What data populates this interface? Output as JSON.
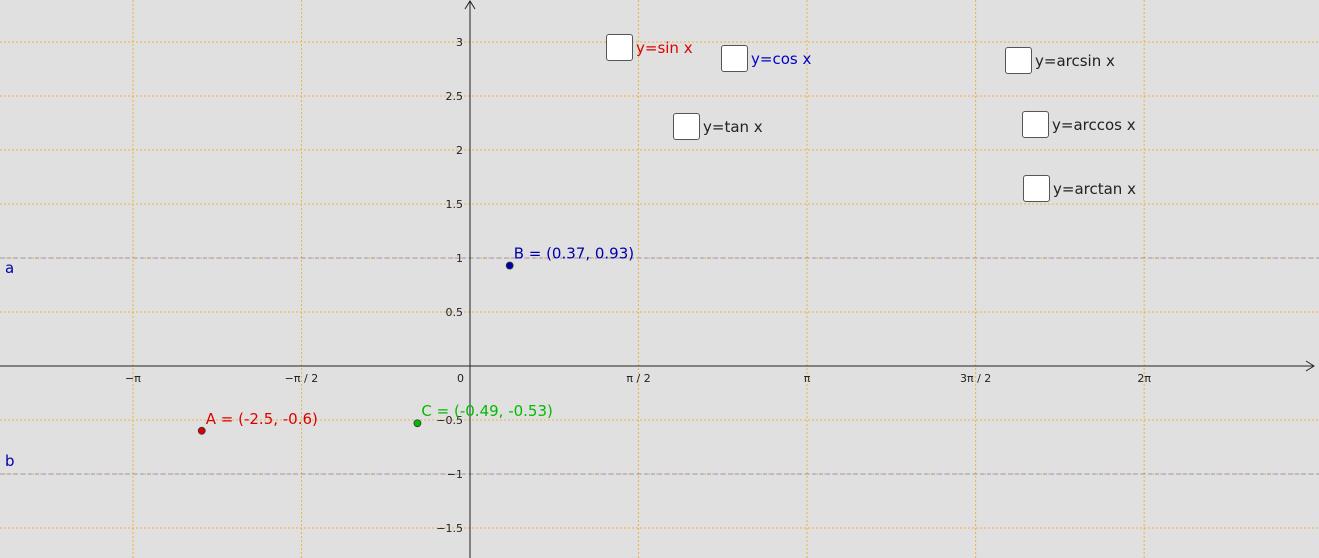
{
  "graph": {
    "x_ticks": [
      "−π",
      "−π / 2",
      "0",
      "π / 2",
      "π",
      "3π / 2",
      "2π"
    ],
    "y_ticks": [
      "3",
      "2.5",
      "2",
      "1.5",
      "1",
      "0.5",
      "−0.5",
      "−1",
      "−1.5"
    ],
    "lines": [
      {
        "name": "a",
        "y": 1,
        "color": "#0000aa"
      },
      {
        "name": "b",
        "y": -1,
        "color": "#0000aa"
      }
    ],
    "points": [
      {
        "label": "A = (-2.5, -0.6)",
        "x": -2.5,
        "y": -0.6,
        "color": "#dd0000"
      },
      {
        "label": "B = (0.37, 0.93)",
        "x": 0.37,
        "y": 0.93,
        "color": "#0000aa"
      },
      {
        "label": "C = (-0.49, -0.53)",
        "x": -0.49,
        "y": -0.53,
        "color": "#00bb00"
      }
    ]
  },
  "checkboxes": {
    "sin": {
      "label": "y=sin x",
      "checked": false,
      "color": "#dd0000"
    },
    "cos": {
      "label": "y=cos x",
      "checked": false,
      "color": "#0000cc"
    },
    "tan": {
      "label": "y=tan x",
      "checked": false,
      "color": "#222222"
    },
    "arcsin": {
      "label": "y=arcsin x",
      "checked": false,
      "color": "#222222"
    },
    "arccos": {
      "label": "y=arccos x",
      "checked": false,
      "color": "#222222"
    },
    "arctan": {
      "label": "y=arctan x",
      "checked": false,
      "color": "#222222"
    }
  }
}
